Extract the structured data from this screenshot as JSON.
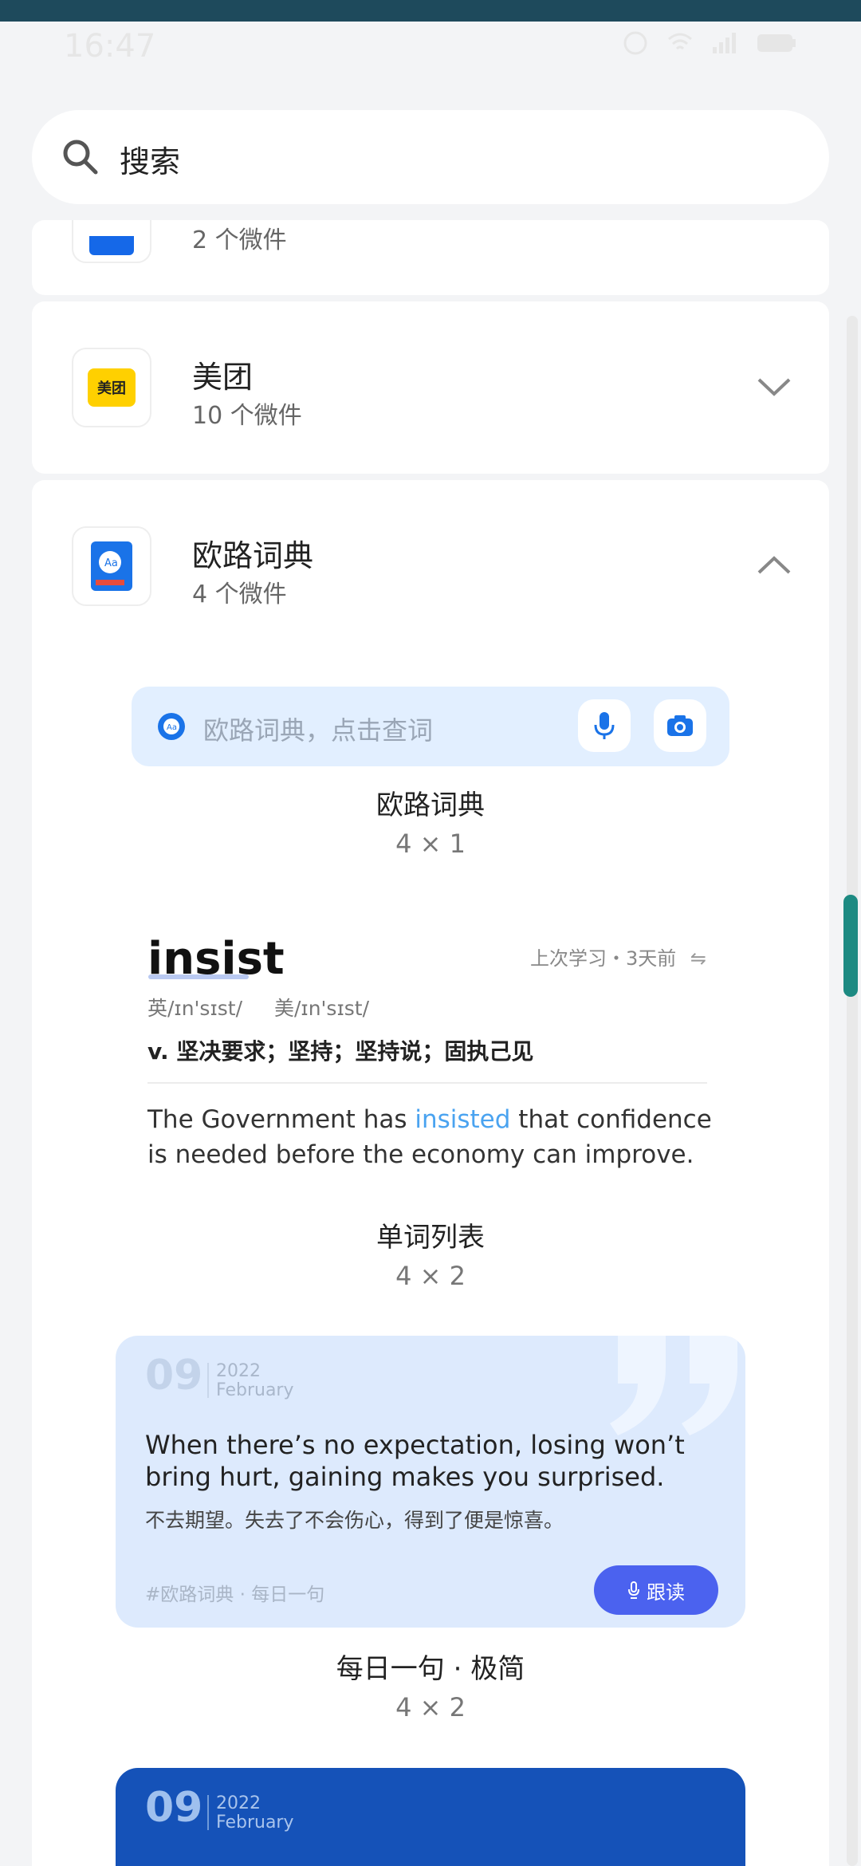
{
  "status": {
    "time": "16:47"
  },
  "search": {
    "placeholder": "搜索"
  },
  "apps": [
    {
      "name": "",
      "count": "2 个微件"
    },
    {
      "name": "美团",
      "count": "10 个微件",
      "icon_text": "美团"
    },
    {
      "name": "欧路词典",
      "count": "4 个微件"
    }
  ],
  "dict_widget": {
    "placeholder": "欧路词典，点击查词",
    "caption": "欧路词典",
    "size": "4 × 1"
  },
  "word_widget": {
    "word": "insist",
    "last_study": "上次学习・3天前",
    "phon_uk": "英/ɪn'sɪst/",
    "phon_us": "美/ɪn'sɪst/",
    "meaning": "v.  坚决要求；坚持；坚持说；固执己见",
    "example_pre": "The Government has ",
    "example_hl": "insisted",
    "example_post": " that confidence is needed before the economy can improve.",
    "caption": "单词列表",
    "size": "4 × 2"
  },
  "quote_widget": {
    "day": "09",
    "year": "2022",
    "month": "February",
    "en": "When there’s no expectation, losing won’t bring hurt, gaining makes you surprised.",
    "zh": "不去期望。失去了不会伤心，得到了便是惊喜。",
    "tag": "#欧路词典 · 每日一句",
    "button": "跟读",
    "caption": "每日一句 · 极简",
    "size": "4 × 2"
  },
  "quote_widget2": {
    "day": "09",
    "year": "2022",
    "month": "February"
  },
  "colors": {
    "accent": "#4b62ef",
    "scroll": "#1d8a82",
    "widget_bg": "#e2efff"
  }
}
